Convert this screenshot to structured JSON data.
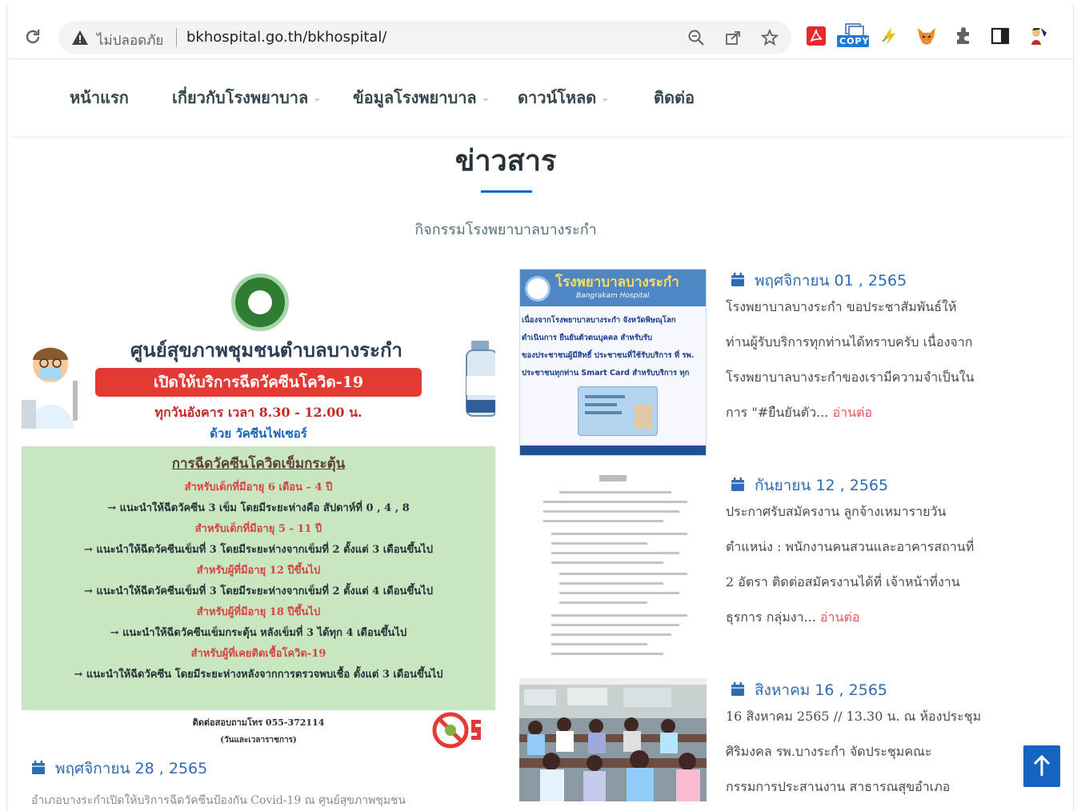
{
  "browser": {
    "security_label": "ไม่ปลอดภัย",
    "url": "bkhospital.go.th/bkhospital/",
    "copy_badge": "COPY"
  },
  "nav": {
    "items": [
      {
        "label": "หน้าแรก",
        "dropdown": false
      },
      {
        "label": "เกี่ยวกับโรงพยาบาล",
        "dropdown": true
      },
      {
        "label": "ข้อมูลโรงพยาบาล",
        "dropdown": true
      },
      {
        "label": "ดาวน์โหลด",
        "dropdown": true
      },
      {
        "label": "ติดต่อ",
        "dropdown": false
      }
    ]
  },
  "section": {
    "title": "ข่าวสาร",
    "subtitle": "กิจกรรมโรงพยาบาลบางระกำ"
  },
  "poster": {
    "heading": "ศูนย์สุขภาพชุมชนตำบลบางระกำ",
    "banner": "เปิดให้บริการฉีดวัคซีนโควิด-19",
    "schedule": "ทุกวันอังคาร เวลา 8.30 - 12.00 น.",
    "vaccine": "ด้วย วัคซีนไฟเซอร์",
    "booster_title": "การฉีดวัคซีนโควิดเข็มกระตุ้น",
    "lines": [
      {
        "text": "สำหรับเด็กที่มีอายุ 6 เดือน – 4 ปี",
        "style": "red"
      },
      {
        "text": "→ แนะนำให้ฉีดวัคซีน 3 เข็ม โดยมีระยะห่างคือ สัปดาห์ที่ 0 , 4 , 8",
        "style": "dark"
      },
      {
        "text": "สำหรับเด็กที่มีอายุ 5 - 11 ปี",
        "style": "red"
      },
      {
        "text": "→ แนะนำให้ฉีดวัคซีนเข็มที่ 3 โดยมีระยะห่างจากเข็มที่ 2 ตั้งแต่ 3 เดือนขึ้นไป",
        "style": "dark"
      },
      {
        "text": "สำหรับผู้ที่มีอายุ 12 ปีขึ้นไป",
        "style": "red"
      },
      {
        "text": "→ แนะนำให้ฉีดวัคซีนเข็มที่ 3 โดยมีระยะห่างจากเข็มที่ 2 ตั้งแต่ 4 เดือนขึ้นไป",
        "style": "dark"
      },
      {
        "text": "สำหรับผู้ที่มีอายุ 18 ปีขึ้นไป",
        "style": "red"
      },
      {
        "text": "→ แนะนำให้ฉีดวัคซีนเข็มกระตุ้น หลังเข็มที่ 3 ได้ทุก 4 เดือนขึ้นไป",
        "style": "dark"
      },
      {
        "text": "สำหรับผู้ที่เคยติดเชื้อโควิด-19",
        "style": "red"
      },
      {
        "text": "→ แนะนำให้ฉีดวัคซีน โดยมีระยะห่างหลังจากการตรวจพบเชื้อ ตั้งแต่ 3 เดือนขึ้นไป",
        "style": "dark"
      }
    ],
    "contact": "ติดต่อสอบถามโทร 055-372114",
    "contact_hours": "(วันและเวลาราชการ)"
  },
  "thumb1": {
    "title": "โรงพยาบาลบางระกำ",
    "subtitle": "Bangrakam Hospital",
    "lines": [
      "เนื่องจากโรงพยาบาลบางระกำ จังหวัดพิษณุโลก",
      "ดำเนินการ ยืนยันตัวตนบุคคล สำหรับรับ",
      "ของประชาชนผู้มีสิทธิ์ ประชาชนที่ใช้รับบริการ ที่ รพ.",
      "ประชาชนทุกท่าน Smart Card สำหรับบริการ ทุก"
    ]
  },
  "posts": [
    {
      "date": "พฤศจิกายน 01 , 2565",
      "lines": [
        "โรงพยาบาลบางระกำ ขอประชาสัมพันธ์ให้",
        "ท่านผู้รับบริการทุกท่านได้ทราบครับ เนื่องจาก",
        "โรงพยาบาลบางระกำของเรามีความจำเป็นใน"
      ],
      "last_line": "การ \"#ยืนยันตัว... ",
      "read_more": "อ่านต่อ"
    },
    {
      "date": "กันยายน 12 , 2565",
      "lines": [
        "ประกาศรับสมัครงาน ลูกจ้างเหมารายวัน",
        "ตำแหน่ง : พนักงานคนสวนและอาคารสถานที่",
        "2 อัตรา ติดต่อสมัครงานได้ที่ เจ้าหน้าที่งาน"
      ],
      "last_line": "ธุรการ กลุ่มงา... ",
      "read_more": "อ่านต่อ"
    },
    {
      "date": "สิงหาคม 16 , 2565",
      "lines": [
        "16 สิงหาคม 2565 // 13.30 น. ณ ห้องประชุม",
        "ศิริมงคล รพ.บางระกำ จัดประชุมคณะ",
        "กรรมการประสานงาน สาธารณสุขอำเภอ"
      ],
      "last_line": "",
      "read_more": ""
    }
  ],
  "main_post": {
    "date": "พฤศจิกายน 28 , 2565",
    "excerpt": "อำเภอบางระกำเปิดให้บริการฉีดวัคซีนป้องกัน Covid-19 ณ ศูนย์สุขภาพชุมชน"
  },
  "colors": {
    "accent": "#2e6bb5",
    "read_more": "#e25555",
    "scroll_top": "#1565c0"
  }
}
